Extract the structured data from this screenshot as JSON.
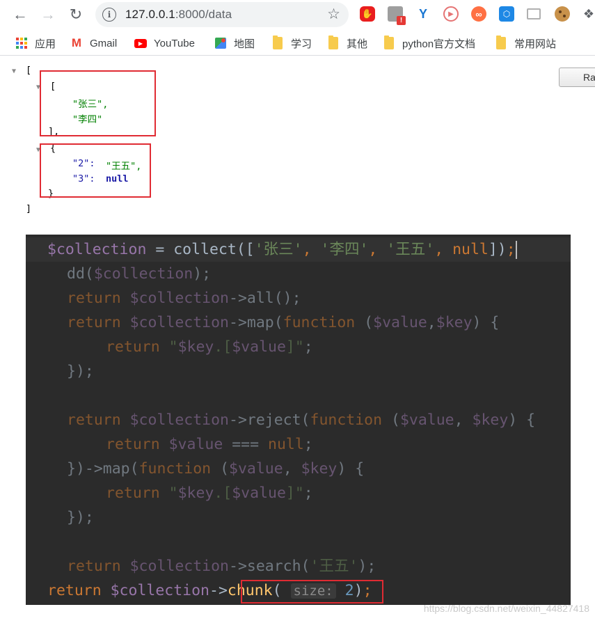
{
  "browser": {
    "back_icon": "arrow-left-icon",
    "forward_icon": "arrow-right-icon",
    "reload_icon": "reload-icon",
    "url_host": "127.0.0.1",
    "url_path": ":8000/data",
    "bookmark_star_icon": "star-icon",
    "extensions": [
      "adblock-icon",
      "extension-alert-icon",
      "y-extension-icon",
      "play-extension-icon",
      "infinity-extension-icon",
      "hex-extension-icon",
      "monitor-extension-icon",
      "cookie-extension-icon",
      "puzzle-icon"
    ],
    "colors": {
      "accent": "#1a73e8",
      "adblock": "#e91e1e",
      "alert": "#e53935"
    }
  },
  "bookmarks": [
    {
      "label": "应用",
      "icon": "apps-grid-icon"
    },
    {
      "label": "Gmail",
      "icon": "gmail-icon"
    },
    {
      "label": "YouTube",
      "icon": "youtube-icon"
    },
    {
      "label": "地图",
      "icon": "maps-icon"
    },
    {
      "label": "学习",
      "icon": "folder-icon"
    },
    {
      "label": "其他",
      "icon": "folder-icon"
    },
    {
      "label": "python官方文档",
      "icon": "folder-icon"
    },
    {
      "label": "常用网站",
      "icon": "folder-icon"
    }
  ],
  "json_view": {
    "open_bracket": "[",
    "close_bracket": "]",
    "inner_array": {
      "open": "[",
      "items": [
        "\"张三\",",
        "\"李四\""
      ],
      "close": "],"
    },
    "inner_object": {
      "open": "{",
      "entries": [
        {
          "key": "\"2\":",
          "value": "\"王五\","
        },
        {
          "key": "\"3\":",
          "value": "null"
        }
      ],
      "close": "}"
    },
    "raw_button": "Ra"
  },
  "code": {
    "lines": [
      "$collection = collect(['张三', '李四', '王五', null]);",
      "dd($collection);",
      "return $collection->all();",
      "return $collection->map(function ($value,$key) {",
      "return \"$key.[$value]\";",
      "});",
      "",
      "return $collection->reject(function ($value, $key) {",
      "return $value === null;",
      "})->map(function ($value, $key) {",
      "return \"$key.[$value]\";",
      "});",
      "",
      "return $collection->search('王五');",
      "return $collection->chunk( size: 2);"
    ],
    "colors": {
      "background": "#2b2b2b",
      "variable": "#9876aa",
      "keyword": "#cc7832",
      "string": "#6a8759",
      "function": "#ffc66d",
      "number": "#6897bb"
    }
  },
  "watermark": "https://blog.csdn.net/weixin_44827418"
}
